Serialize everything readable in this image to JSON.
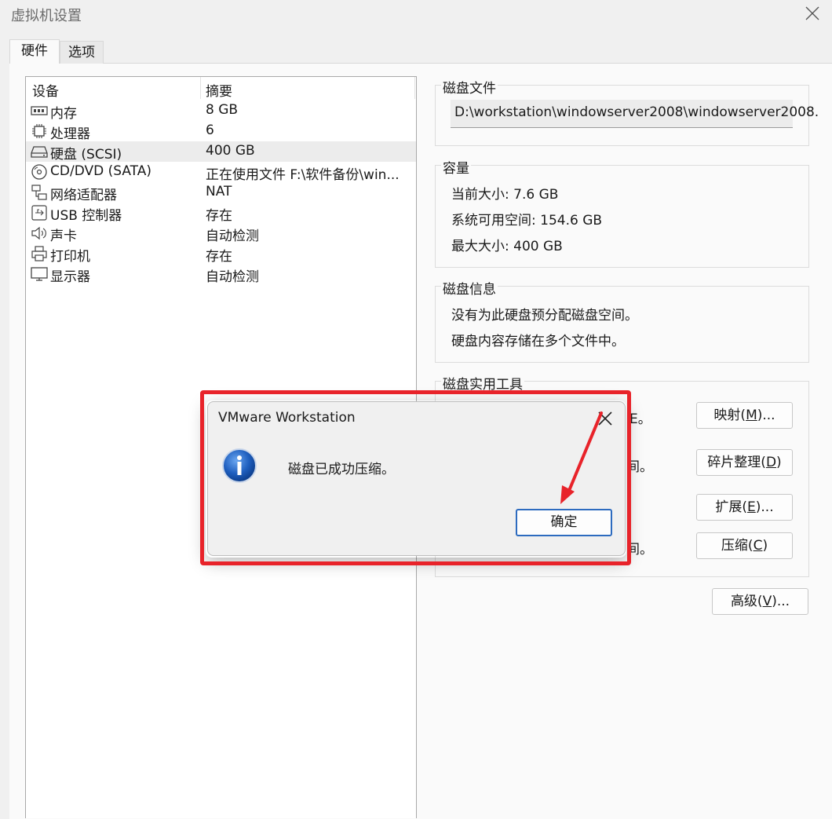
{
  "window": {
    "title": "虚拟机设置"
  },
  "tabs": [
    {
      "label": "硬件"
    },
    {
      "label": "选项"
    }
  ],
  "device_list": {
    "columns": {
      "device": "设备",
      "summary": "摘要"
    },
    "items": [
      {
        "icon": "memory-icon",
        "name": "内存",
        "summary": "8 GB"
      },
      {
        "icon": "processor-icon",
        "name": "处理器",
        "summary": "6"
      },
      {
        "icon": "harddisk-icon",
        "name": "硬盘 (SCSI)",
        "summary": "400 GB",
        "selected": true
      },
      {
        "icon": "cd-dvd-icon",
        "name": "CD/DVD (SATA)",
        "summary": "正在使用文件 F:\\软件备份\\win..."
      },
      {
        "icon": "network-adapter-icon",
        "name": "网络适配器",
        "summary": "NAT"
      },
      {
        "icon": "usb-icon",
        "name": "USB 控制器",
        "summary": "存在"
      },
      {
        "icon": "sound-icon",
        "name": "声卡",
        "summary": "自动检测"
      },
      {
        "icon": "printer-icon",
        "name": "打印机",
        "summary": "存在"
      },
      {
        "icon": "display-icon",
        "name": "显示器",
        "summary": "自动检测"
      }
    ]
  },
  "disk_file": {
    "group_title": "磁盘文件",
    "path": "D:\\workstation\\windowserver2008\\windowserver2008."
  },
  "capacity": {
    "group_title": "容量",
    "current_size_label": "当前大小:",
    "current_size_value": "7.6 GB",
    "free_space_label": "系统可用空间:",
    "free_space_value": "154.6 GB",
    "max_size_label": "最大大小:",
    "max_size_value": "400 GB"
  },
  "disk_info": {
    "group_title": "磁盘信息",
    "line1": "没有为此硬盘预分配磁盘空间。",
    "line2": "硬盘内容存储在多个文件中。"
  },
  "disk_utilities": {
    "group_title": "磁盘实用工具",
    "partial_texts": [
      "E。",
      "间。",
      "间。"
    ],
    "map_button": {
      "text": "映射(",
      "key": "M",
      "suffix": ")..."
    },
    "defrag_button": {
      "text": "碎片整理(",
      "key": "D",
      "suffix": ")"
    },
    "expand_button": {
      "text": "扩展(",
      "key": "E",
      "suffix": ")..."
    },
    "compact_button": {
      "text": "压缩(",
      "key": "C",
      "suffix": ")"
    }
  },
  "advanced_button": {
    "text": "高级(",
    "key": "V",
    "suffix": ")..."
  },
  "dialog": {
    "title": "VMware Workstation",
    "message": "磁盘已成功压缩。",
    "ok_label": "确定",
    "icon": "info-icon"
  },
  "colors": {
    "highlight": "#e8232a",
    "accent": "#2d6bbf",
    "info_blue": "#1f5fbf"
  }
}
